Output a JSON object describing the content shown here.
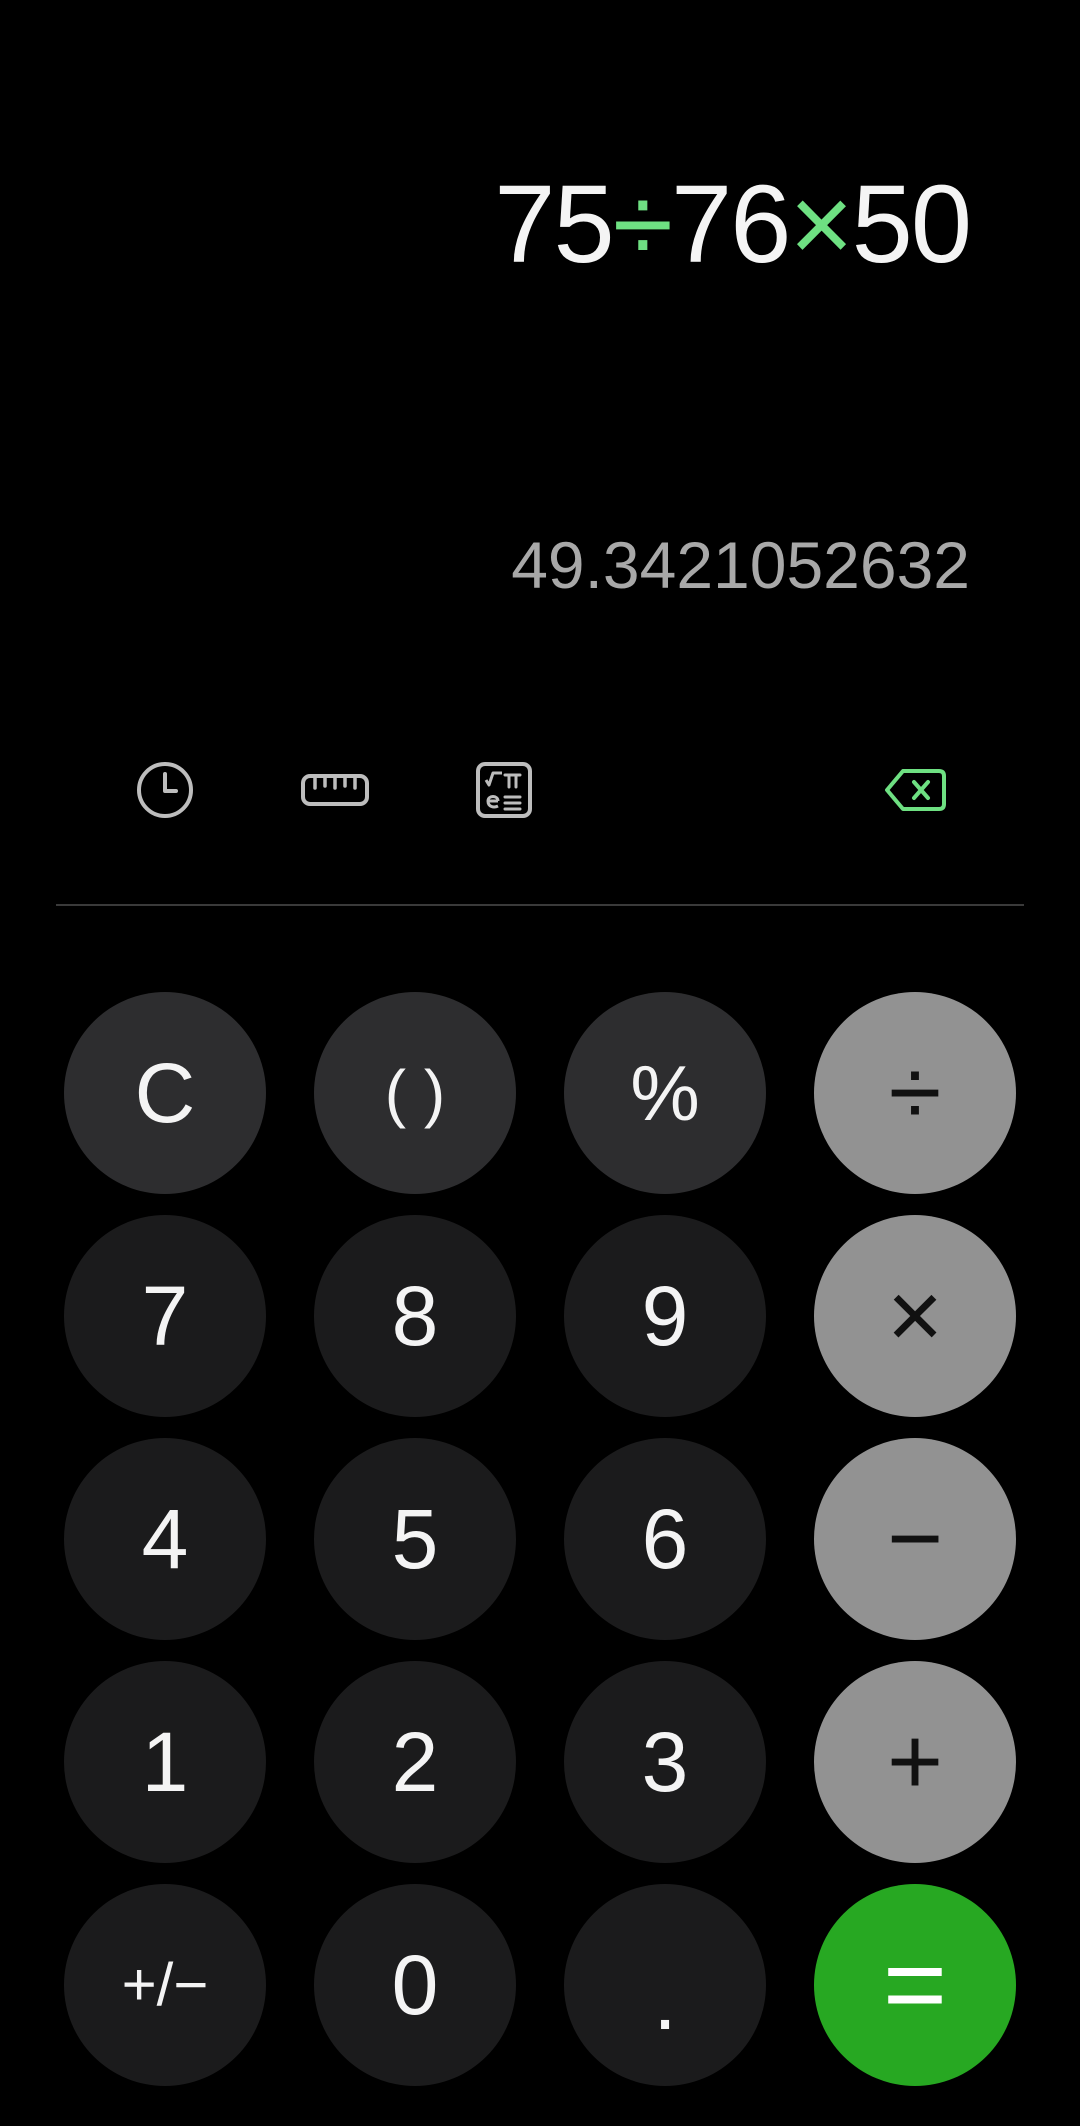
{
  "display": {
    "expression": {
      "n1": "75",
      "op1": "÷",
      "n2": "76",
      "op2": "×",
      "n3": "50"
    },
    "preview": "49.3421052632"
  },
  "toolbar": {
    "icons": [
      "history-icon",
      "ruler-icon",
      "scientific-icon",
      "backspace-icon"
    ]
  },
  "colors": {
    "accent": "#6ee082",
    "equals": "#27a822",
    "operator_key": "#929292",
    "function_key": "#2d2d2f",
    "digit_key": "#1b1b1c"
  },
  "keypad": {
    "clear": "C",
    "parens": "( )",
    "percent": "%",
    "divide": "÷",
    "seven": "7",
    "eight": "8",
    "nine": "9",
    "multiply": "×",
    "four": "4",
    "five": "5",
    "six": "6",
    "minus": "−",
    "one": "1",
    "two": "2",
    "three": "3",
    "plus": "+",
    "sign": "+/−",
    "zero": "0",
    "decimal": ".",
    "equals": "="
  }
}
